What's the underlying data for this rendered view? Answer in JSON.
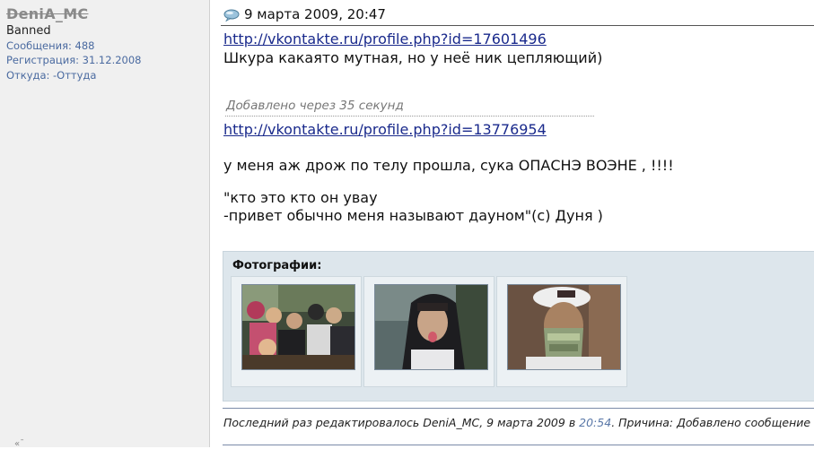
{
  "user": {
    "name": "DeniA_MC",
    "rank": "Banned",
    "posts": "Сообщения: 488",
    "registered": "Регистрация: 31.12.2008",
    "from": "Откуда: -Оттуда",
    "bottom_marks": "«¯"
  },
  "post": {
    "icon": "speech-bubble-icon",
    "date": "9 марта 2009, 20:47",
    "link1": "http://vkontakte.ru/profile.php?id=17601496",
    "line1": "Шкура какаято мутная, но у неё ник цепляющий)",
    "added_note": "Добавлено через 35 секунд",
    "link2": "http://vkontakte.ru/profile.php?id=13776954",
    "line2": "у меня аж дрож по телу прошла, сука ОПАСНЭ ВОЭНЕ , !!!!",
    "quote1": "\"кто это кто он увау",
    "quote2": "-привет обычно меня называют дауном\"(с) Дуня )"
  },
  "photos": {
    "title": "Фотографии:",
    "items": [
      "group-photo",
      "portrait-photo",
      "masked-photo"
    ]
  },
  "edit": {
    "prefix": "Последний раз редактировалось DeniA_MC, 9 марта 2009 в ",
    "time": "20:54",
    "suffix": ". Причина: Добавлено сообщение"
  },
  "colors": {
    "link": "#1a2a8c",
    "sidebar_bg": "#f0f0f0",
    "stat_text": "#4a6aa0",
    "photos_bg": "#dde6ec"
  }
}
